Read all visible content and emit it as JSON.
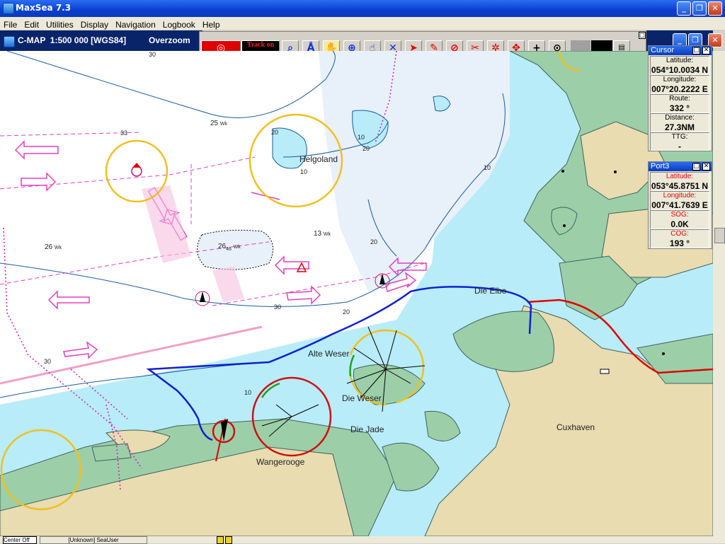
{
  "window": {
    "title": "MaxSea 7.3"
  },
  "menu": [
    "File",
    "Edit",
    "Utilities",
    "Display",
    "Navigation",
    "Logbook",
    "Help"
  ],
  "chart_header": {
    "label": "C-MAP  1:500 000 [WGS84]",
    "mode": "Overzoom"
  },
  "toolbar": {
    "track_label": "Track on"
  },
  "map": {
    "places": {
      "helgoland": "Helgoland",
      "die_elbe": "Die Elbe",
      "alte_weser": "Alte Weser",
      "die_weser": "Die Weser",
      "die_jade": "Die Jade",
      "cuxhaven": "Cuxhaven",
      "wangerooge": "Wangerooge"
    },
    "depths": {
      "d30_top": "30",
      "d20_top": "20",
      "d10_helg": "10",
      "d10_a": "10",
      "d20_b": "20",
      "d10_right": "10",
      "d20_mid": "20",
      "d30_mid": "30",
      "d20_low": "20",
      "d10_low": "10",
      "d30_left": "30",
      "d33": "33"
    },
    "wrecks": {
      "w1_num": "25",
      "w1_lbl": "Wk",
      "w2_num": "26",
      "w2_lbl": "Wk",
      "w3_num": "26",
      "w3_lbl": "Wk",
      "w4_num": "13",
      "w4_lbl": "Wk",
      "w5_sub": "46"
    }
  },
  "panels": {
    "cursor": {
      "title": "Cursor",
      "fields": [
        {
          "label": "Latitude:",
          "value": "054°10.0034 N"
        },
        {
          "label": "Longitude:",
          "value": "007°20.2222 E"
        },
        {
          "label": "Route:",
          "value": "332 °"
        },
        {
          "label": "Distance:",
          "value": "27.3NM"
        },
        {
          "label": "TTG:",
          "value": "-"
        }
      ]
    },
    "port3": {
      "title": "Port3",
      "fields": [
        {
          "label": "Latitude:",
          "value": "053°45.8751 N"
        },
        {
          "label": "Longitude:",
          "value": "007°41.7639 E"
        },
        {
          "label": "SOG:",
          "value": "0.0K"
        },
        {
          "label": "COG:",
          "value": "193 °"
        }
      ]
    }
  },
  "statusbar": {
    "left": "Center Off",
    "user": "[Unknown] SeaUser"
  },
  "colors": {
    "deep_water": "#ffffff",
    "shallow_water": "#b8ecf8",
    "land": "#e8dcb0",
    "tidal_flat": "#9ccfa8",
    "track": "#1020d0",
    "route": "#e00000",
    "traffic_sep": "#e040c0",
    "range_ring": "#f0c020"
  }
}
